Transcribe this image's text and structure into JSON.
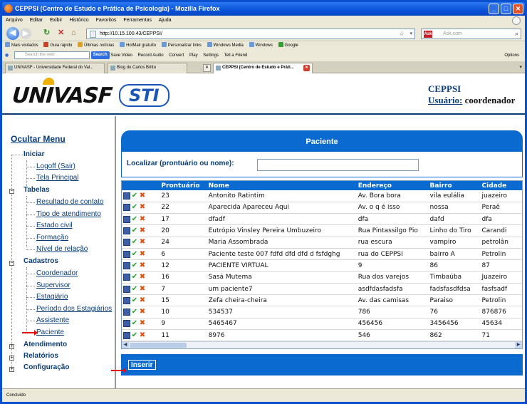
{
  "window": {
    "title": "CEPPSI (Centro de Estudo e Prática de Psicologia) - Mozilla Firefox"
  },
  "menu": [
    "Arquivo",
    "Editar",
    "Exibir",
    "Histórico",
    "Favoritos",
    "Ferramentas",
    "Ajuda"
  ],
  "nav": {
    "url": "http://10.15.100.43/CEPPSI/",
    "search_placeholder": "Ask.com"
  },
  "bookmarks": [
    "Mais visitados",
    "Guia rápido",
    "Últimas notícias",
    "HotMail gratuito",
    "Personalizar links",
    "Windows Media",
    "Windows",
    "Google"
  ],
  "toolbar2": {
    "search_placeholder": "Search the web",
    "search_btn": "Search",
    "items": [
      "Save Video",
      "Record Audio",
      "Convert",
      "Play",
      "Settings",
      "Tell a Friend"
    ],
    "options": "Options"
  },
  "tabs": [
    "UNIVASF - Universidade Federal do Val...",
    "Blog do Carlos Britto",
    "CEPPSI (Centro de Estudo e Práti..."
  ],
  "header": {
    "logo_left": "UNIVASF",
    "logo_right": "STI",
    "app_name": "CEPPSI",
    "user_label": "Usuário:",
    "user_value": "coordenador"
  },
  "sidebar": {
    "toggle": "Ocultar Menu",
    "inicio": "Iniciar",
    "inicio_items": [
      "Logoff (Sair)",
      "Tela Principal"
    ],
    "tabelas": "Tabelas",
    "tabelas_items": [
      "Resultado de contato",
      "Tipo de atendimento",
      "Estado civil",
      "Formação",
      "Nível de relação"
    ],
    "cadastros": "Cadastros",
    "cadastros_items": [
      "Coordenador",
      "Supervisor",
      "Estagiário",
      "Período dos Estagiários",
      "Assistente",
      "Paciente"
    ],
    "atendimento": "Atendimento",
    "relatorios": "Relatórios",
    "configuracao": "Configuração"
  },
  "panel": {
    "title": "Paciente",
    "search_label": "Localizar (prontuário ou nome):",
    "search_value": "",
    "columns": [
      "Prontuário",
      "Nome",
      "Endereço",
      "Bairro",
      "Cidade"
    ],
    "rows": [
      [
        "23",
        "Antonito Ratintim",
        "Av. Bora bora",
        "vila eulália",
        "juazeiro"
      ],
      [
        "22",
        "Aparecida Apareceu Aqui",
        "Av. o q é isso",
        "nossa",
        "Peraê"
      ],
      [
        "17",
        "dfadf",
        "dfa",
        "dafd",
        "dfa"
      ],
      [
        "20",
        "Eutrópio Vinsley Pereira Umbuzeiro",
        "Rua Pintassilgo Pio",
        "Linho do Tiro",
        "Carandi"
      ],
      [
        "24",
        "Maria Assombrada",
        "rua escura",
        "vampiro",
        "petrolân"
      ],
      [
        "6",
        "Paciente teste 007 fdfd dfd dfd d fsfdghg",
        "rua do CEPPSI",
        "bairro A",
        "Petrolin"
      ],
      [
        "12",
        "PACIENTE VIRTUAL",
        "9",
        "86",
        "87"
      ],
      [
        "16",
        "Sasá Mutema",
        "Rua dos varejos",
        "Timbaúba",
        "Juazeiro"
      ],
      [
        "7",
        "um paciente7",
        "asdfdasfadsfa",
        "fadsfasdfdsa",
        "fasfsadf"
      ],
      [
        "15",
        "Zefa cheira-cheira",
        "Av. das camisas",
        "Paraiso",
        "Petrolin"
      ],
      [
        "10",
        "534537",
        "786",
        "76",
        "876876"
      ],
      [
        "9",
        "5465467",
        "456456",
        "3456456",
        "45634"
      ],
      [
        "11",
        "8976",
        "546",
        "862",
        "71"
      ]
    ],
    "insert_button": "Inserir"
  },
  "status": "Concluído"
}
